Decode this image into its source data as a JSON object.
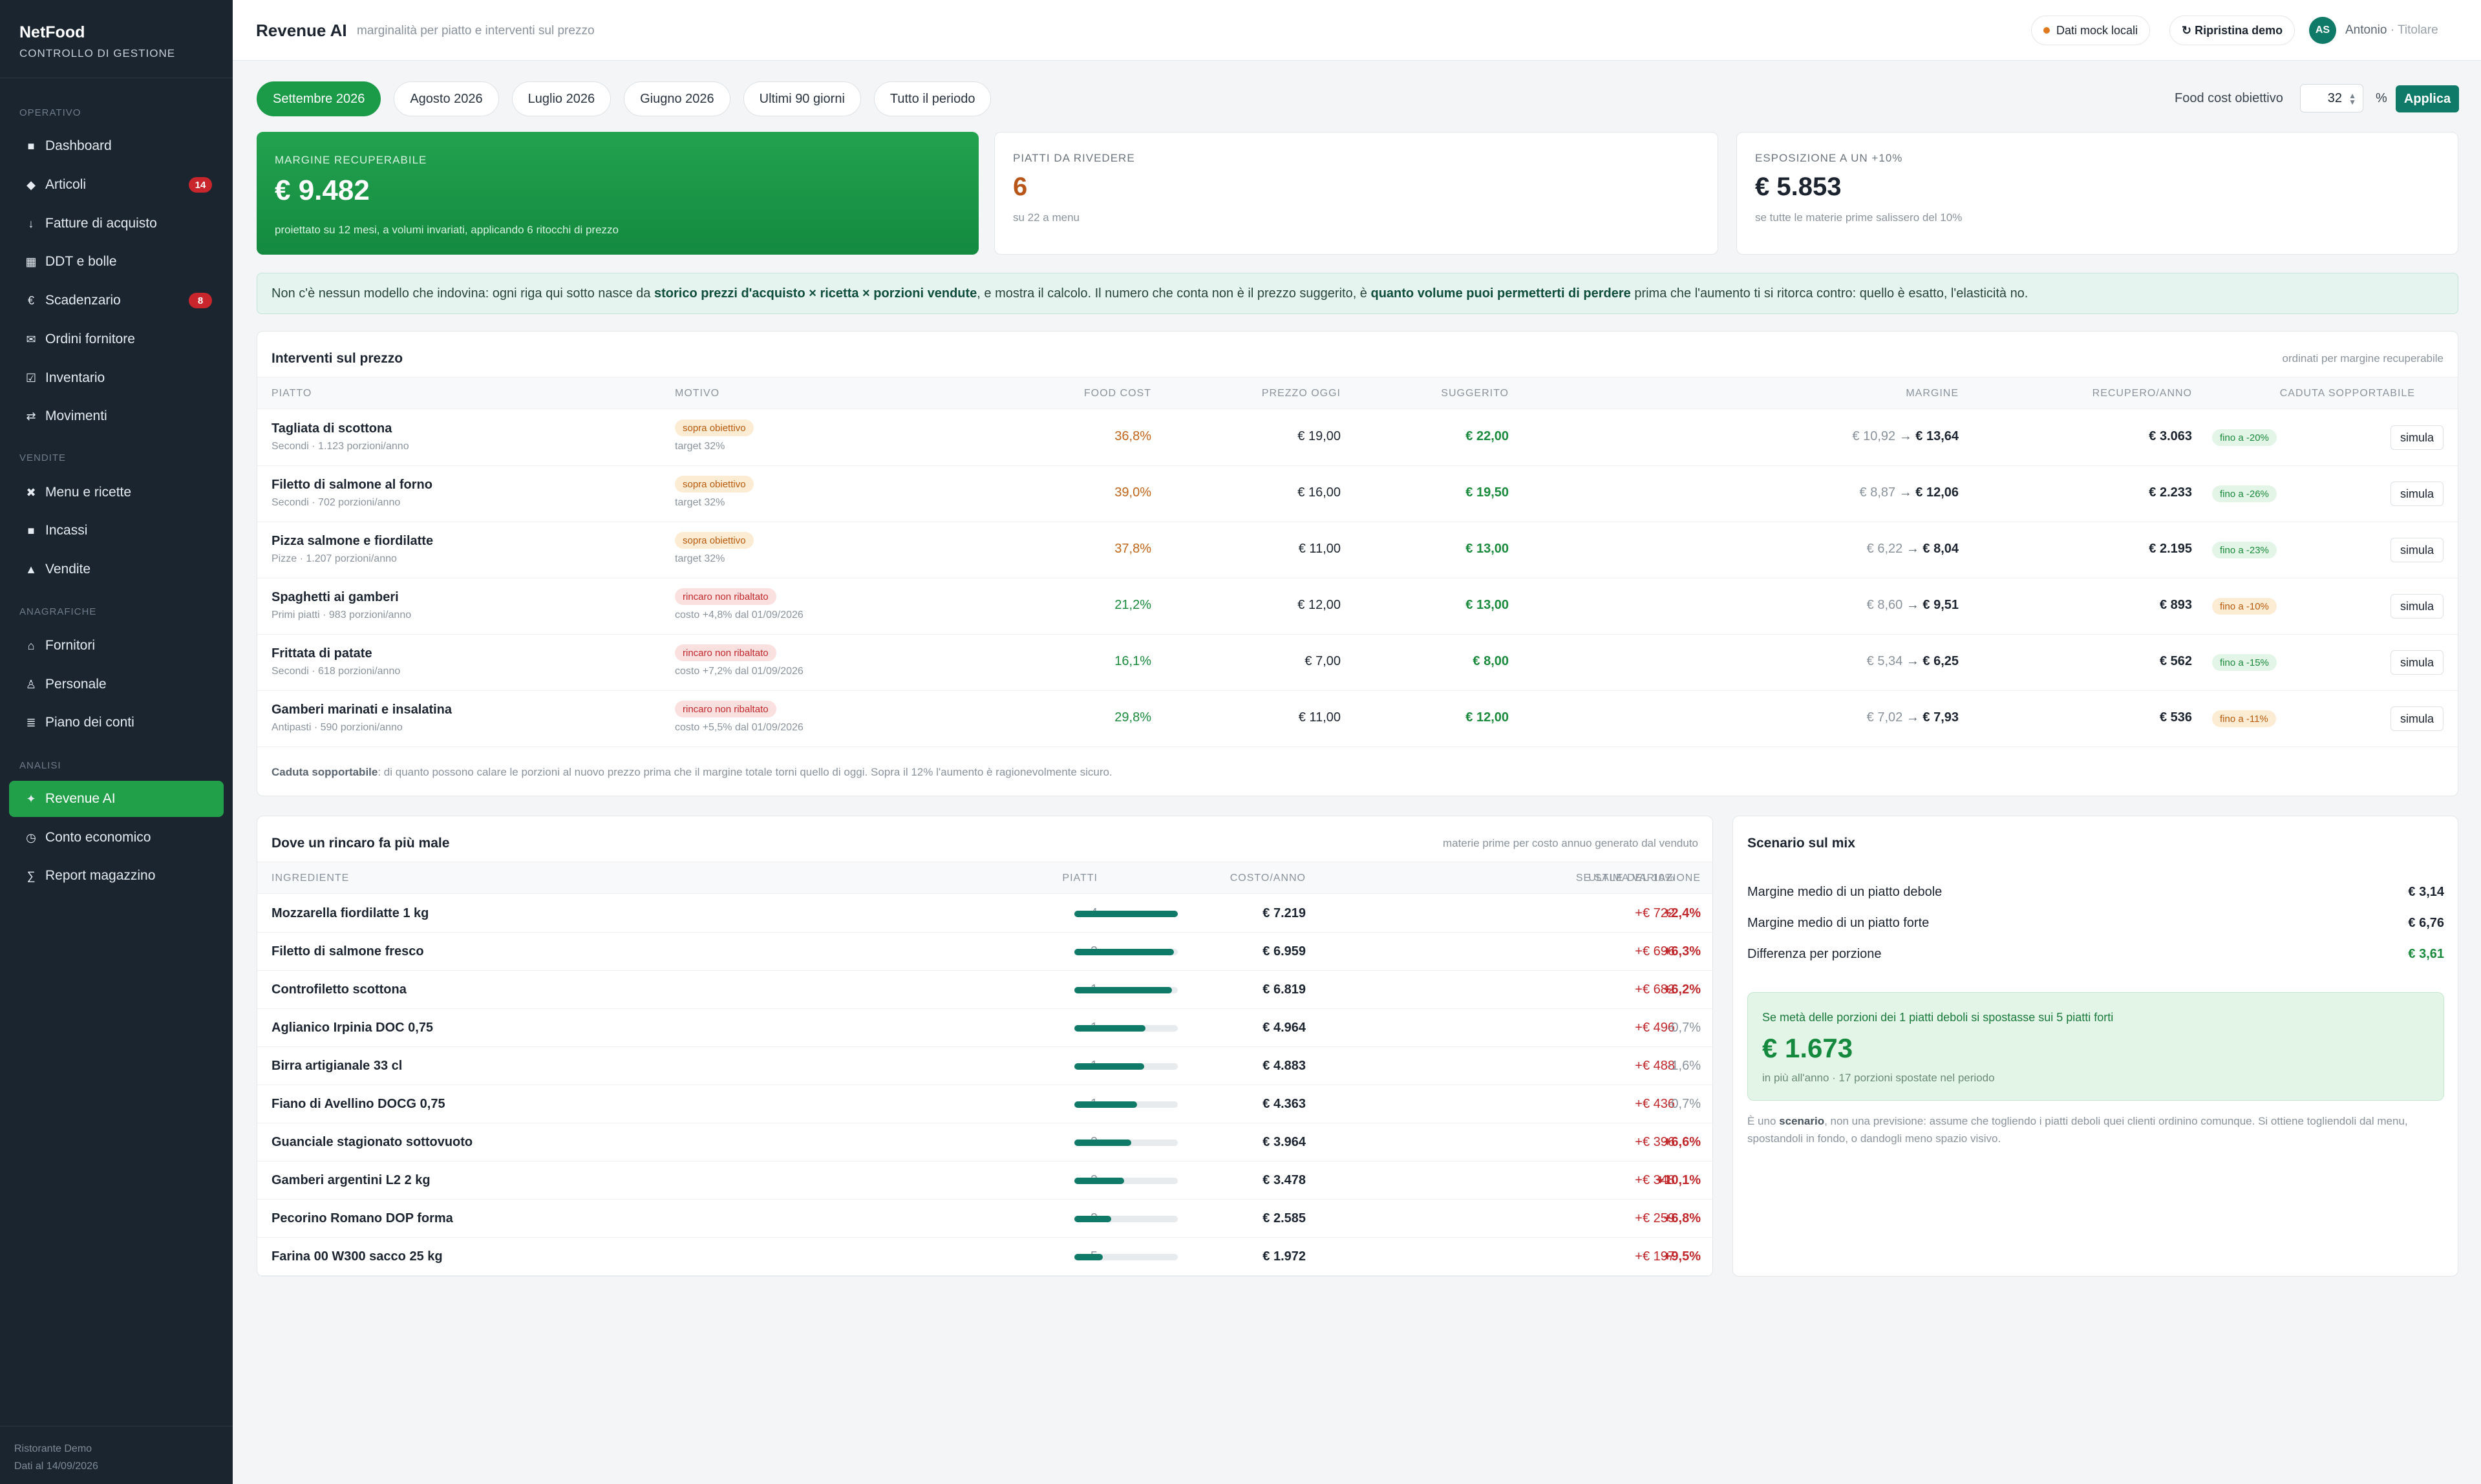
{
  "sidebar": {
    "brand": "NetFood",
    "subtitle": "CONTROLLO DI GESTIONE",
    "sections": {
      "operativo": "OPERATIVO",
      "vendite": "VENDITE",
      "anagrafiche": "ANAGRAFICHE",
      "analisi": "ANALISI"
    },
    "items": [
      {
        "label": "Dashboard",
        "icon": "dashboard-icon",
        "glyph": "■"
      },
      {
        "label": "Articoli",
        "icon": "diamond-icon",
        "glyph": "◆",
        "badge": "14"
      },
      {
        "label": "Fatture di acquisto",
        "icon": "download-icon",
        "glyph": "↓"
      },
      {
        "label": "DDT e bolle",
        "icon": "grid-icon",
        "glyph": "▦"
      },
      {
        "label": "Scadenzario",
        "icon": "euro-icon",
        "glyph": "€",
        "badge": "8"
      },
      {
        "label": "Ordini fornitore",
        "icon": "mail-icon",
        "glyph": "✉"
      },
      {
        "label": "Inventario",
        "icon": "checkbox-icon",
        "glyph": "☑"
      },
      {
        "label": "Movimenti",
        "icon": "swap-icon",
        "glyph": "⇄"
      },
      {
        "label": "Menu e ricette",
        "icon": "cross-icon",
        "glyph": "✖"
      },
      {
        "label": "Incassi",
        "icon": "cash-icon",
        "glyph": "■"
      },
      {
        "label": "Vendite",
        "icon": "triangle-icon",
        "glyph": "▲"
      },
      {
        "label": "Fornitori",
        "icon": "home-icon",
        "glyph": "⌂"
      },
      {
        "label": "Personale",
        "icon": "person-icon",
        "glyph": "♙"
      },
      {
        "label": "Piano dei conti",
        "icon": "list-icon",
        "glyph": "≣"
      },
      {
        "label": "Revenue AI",
        "icon": "sparkle-icon",
        "glyph": "✦"
      },
      {
        "label": "Conto economico",
        "icon": "clock-icon",
        "glyph": "◷"
      },
      {
        "label": "Report magazzino",
        "icon": "sigma-icon",
        "glyph": "∑"
      }
    ],
    "footer_line1": "Ristorante Demo",
    "footer_line2": "Dati al 14/09/2026"
  },
  "header": {
    "title": "Revenue AI",
    "subtitle": "marginalità per piatto e interventi sul prezzo",
    "mock_chip": "Dati mock locali",
    "reset_chip": "↻ Ripristina demo",
    "avatar": "AS",
    "user_name": "Antonio",
    "user_role": "· Titolare"
  },
  "period_tabs": [
    "Settembre 2026",
    "Agosto 2026",
    "Luglio 2026",
    "Giugno 2026",
    "Ultimi 90 giorni",
    "Tutto il periodo"
  ],
  "food_cost": {
    "label": "Food cost obiettivo",
    "value": "32",
    "unit": "%",
    "apply": "Applica"
  },
  "kpis": [
    {
      "label": "MARGINE RECUPERABILE",
      "value": "€ 9.482",
      "sub": "proiettato su 12 mesi, a volumi invariati, applicando 6 ritocchi di prezzo"
    },
    {
      "label": "PIATTI DA RIVEDERE",
      "value": "6",
      "sub": "su 22 a menu"
    },
    {
      "label": "ESPOSIZIONE A UN +10%",
      "value": "€ 5.853",
      "sub": "se tutte le materie prime salissero del 10%"
    }
  ],
  "info": {
    "p1": "Non c'è nessun modello che indovina: ogni riga qui sotto nasce da ",
    "b1": "storico prezzi d'acquisto × ricetta × porzioni vendute",
    "p2": ", e mostra il calcolo. Il numero che conta non è il prezzo suggerito, è ",
    "b2": "quanto volume puoi permetterti di perdere",
    "p3": " prima che l'aumento ti si ritorca contro: quello è esatto, l'elasticità no."
  },
  "interventions": {
    "title": "Interventi sul prezzo",
    "note": "ordinati per margine recuperabile",
    "headers": [
      "PIATTO",
      "MOTIVO",
      "FOOD COST",
      "PREZZO OGGI",
      "SUGGERITO",
      "MARGINE",
      "RECUPERO/ANNO",
      "CADUTA SOPPORTABILE"
    ],
    "rows": [
      {
        "name": "Tagliata di scottona",
        "sub": "Secondi · 1.123 porzioni/anno",
        "reason": "sopra obiettivo",
        "reason_type": "warn",
        "reason_sub": "target 32%",
        "fc": "36,8%",
        "fc_color": "#c0641a",
        "price": "€ 19,00",
        "sugg": "€ 22,00",
        "m_old": "€ 10,92",
        "m_new": "€ 13,64",
        "rec": "€ 3.063",
        "drop": "fino a -20%",
        "drop_type": "green",
        "sim": "simula"
      },
      {
        "name": "Filetto di salmone al forno",
        "sub": "Secondi · 702 porzioni/anno",
        "reason": "sopra obiettivo",
        "reason_type": "warn",
        "reason_sub": "target 32%",
        "fc": "39,0%",
        "fc_color": "#c0641a",
        "price": "€ 16,00",
        "sugg": "€ 19,50",
        "m_old": "€ 8,87",
        "m_new": "€ 12,06",
        "rec": "€ 2.233",
        "drop": "fino a -26%",
        "drop_type": "green",
        "sim": "simula"
      },
      {
        "name": "Pizza salmone e fiordilatte",
        "sub": "Pizze · 1.207 porzioni/anno",
        "reason": "sopra obiettivo",
        "reason_type": "warn",
        "reason_sub": "target 32%",
        "fc": "37,8%",
        "fc_color": "#c0641a",
        "price": "€ 11,00",
        "sugg": "€ 13,00",
        "m_old": "€ 6,22",
        "m_new": "€ 8,04",
        "rec": "€ 2.195",
        "drop": "fino a -23%",
        "drop_type": "green",
        "sim": "simula"
      },
      {
        "name": "Spaghetti ai gamberi",
        "sub": "Primi piatti · 983 porzioni/anno",
        "reason": "rincaro non ribaltato",
        "reason_type": "red",
        "reason_sub": "costo +4,8% dal 01/09/2026",
        "fc": "21,2%",
        "fc_color": "#1a8a3c",
        "price": "€ 12,00",
        "sugg": "€ 13,00",
        "m_old": "€ 8,60",
        "m_new": "€ 9,51",
        "rec": "€ 893",
        "drop": "fino a -10%",
        "drop_type": "orange",
        "sim": "simula"
      },
      {
        "name": "Frittata di patate",
        "sub": "Secondi · 618 porzioni/anno",
        "reason": "rincaro non ribaltato",
        "reason_type": "red",
        "reason_sub": "costo +7,2% dal 01/09/2026",
        "fc": "16,1%",
        "fc_color": "#1a8a3c",
        "price": "€ 7,00",
        "sugg": "€ 8,00",
        "m_old": "€ 5,34",
        "m_new": "€ 6,25",
        "rec": "€ 562",
        "drop": "fino a -15%",
        "drop_type": "green",
        "sim": "simula"
      },
      {
        "name": "Gamberi marinati e insalatina",
        "sub": "Antipasti · 590 porzioni/anno",
        "reason": "rincaro non ribaltato",
        "reason_type": "red",
        "reason_sub": "costo +5,5% dal 01/09/2026",
        "fc": "29,8%",
        "fc_color": "#1a8a3c",
        "price": "€ 11,00",
        "sugg": "€ 12,00",
        "m_old": "€ 7,02",
        "m_new": "€ 7,93",
        "rec": "€ 536",
        "drop": "fino a -11%",
        "drop_type": "orange",
        "sim": "simula"
      }
    ],
    "footnote_b": "Caduta sopportabile",
    "footnote": ": di quanto possono calare le porzioni al nuovo prezzo prima che il margine totale torni quello di oggi. Sopra il 12% l'aumento è ragionevolmente sicuro."
  },
  "ingredients": {
    "title": "Dove un rincaro fa più male",
    "note": "materie prime per costo annuo generato dal venduto",
    "headers": [
      "INGREDIENTE",
      "PIATTI",
      "COSTO/ANNO",
      "SE SALE DEL 10%",
      "ULTIMA VARIAZIONE"
    ],
    "rows": [
      {
        "name": "Mozzarella fiordilatte 1 kg",
        "dishes": "4",
        "cost": "€ 7.219",
        "share": 1.0,
        "plus10": "+€ 722",
        "var": "+2,4%",
        "var_up": true
      },
      {
        "name": "Filetto di salmone fresco",
        "dishes": "2",
        "cost": "€ 6.959",
        "share": 0.964,
        "plus10": "+€ 696",
        "var": "+6,3%",
        "var_up": true
      },
      {
        "name": "Controfiletto scottona",
        "dishes": "1",
        "cost": "€ 6.819",
        "share": 0.945,
        "plus10": "+€ 682",
        "var": "+6,2%",
        "var_up": true
      },
      {
        "name": "Aglianico Irpinia DOC 0,75",
        "dishes": "1",
        "cost": "€ 4.964",
        "share": 0.688,
        "plus10": "+€ 496",
        "var": "-0,7%",
        "var_up": false
      },
      {
        "name": "Birra artigianale 33 cl",
        "dishes": "1",
        "cost": "€ 4.883",
        "share": 0.676,
        "plus10": "+€ 488",
        "var": "-1,6%",
        "var_up": false
      },
      {
        "name": "Fiano di Avellino DOCG 0,75",
        "dishes": "1",
        "cost": "€ 4.363",
        "share": 0.604,
        "plus10": "+€ 436",
        "var": "-0,7%",
        "var_up": false
      },
      {
        "name": "Guanciale stagionato sottovuoto",
        "dishes": "2",
        "cost": "€ 3.964",
        "share": 0.549,
        "plus10": "+€ 396",
        "var": "+6,6%",
        "var_up": true
      },
      {
        "name": "Gamberi argentini L2 2 kg",
        "dishes": "2",
        "cost": "€ 3.478",
        "share": 0.482,
        "plus10": "+€ 348",
        "var": "+10,1%",
        "var_up": true
      },
      {
        "name": "Pecorino Romano DOP forma",
        "dishes": "2",
        "cost": "€ 2.585",
        "share": 0.358,
        "plus10": "+€ 259",
        "var": "+6,8%",
        "var_up": true
      },
      {
        "name": "Farina 00 W300 sacco 25 kg",
        "dishes": "5",
        "cost": "€ 1.972",
        "share": 0.273,
        "plus10": "+€ 197",
        "var": "+9,5%",
        "var_up": true
      }
    ]
  },
  "mix": {
    "title": "Scenario sul mix",
    "rows": [
      {
        "label": "Margine medio di un piatto debole",
        "value": "€ 3,14"
      },
      {
        "label": "Margine medio di un piatto forte",
        "value": "€ 6,76"
      },
      {
        "label": "Differenza per porzione",
        "value": "€ 3,61"
      }
    ],
    "scenario_head": "Se metà delle porzioni dei 1 piatti deboli si spostasse sui 5 piatti forti",
    "scenario_value": "€ 1.673",
    "scenario_sub": "in più all'anno · 17 porzioni spostate nel periodo",
    "foot_p1": "È uno ",
    "foot_b": "scenario",
    "foot_p2": ", non una previsione: assume che togliendo i piatti deboli quei clienti ordinino comunque. Si ottiene togliendoli dal menu, spostandoli in fondo, o dandogli meno spazio visivo."
  },
  "colors": {
    "accent": "#1b9a48",
    "teal": "#0f7a68",
    "sidebar": "#1b2530",
    "red": "#c0282c",
    "orange": "#c0641a"
  }
}
